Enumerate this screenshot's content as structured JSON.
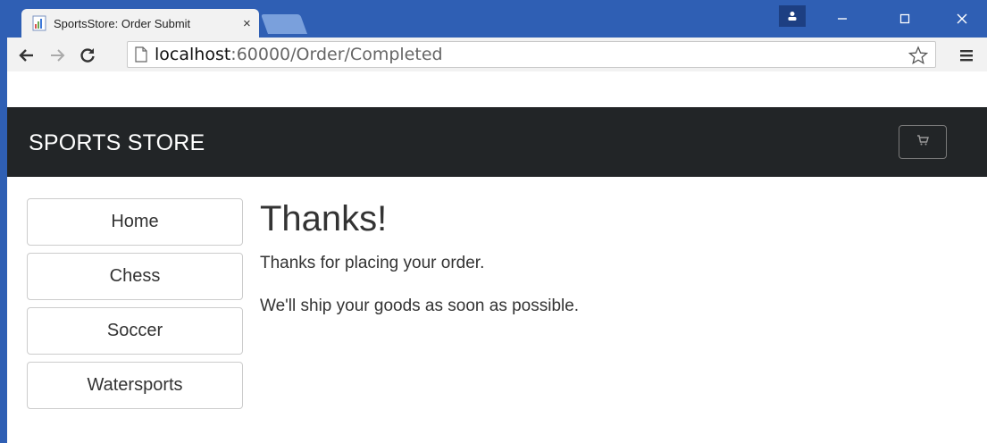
{
  "browser": {
    "tab_title": "SportsStore: Order Submit",
    "tab_close": "×",
    "url_host": "localhost",
    "url_path": ":60000/Order/Completed"
  },
  "navbar": {
    "brand": "SPORTS STORE"
  },
  "sidebar": {
    "items": [
      {
        "label": "Home"
      },
      {
        "label": "Chess"
      },
      {
        "label": "Soccer"
      },
      {
        "label": "Watersports"
      }
    ]
  },
  "main": {
    "heading": "Thanks!",
    "paragraph1": "Thanks for placing your order.",
    "paragraph2": "We'll ship your goods as soon as possible."
  },
  "colors": {
    "chrome_blue": "#2f5fb4",
    "navbar_dark": "#222527"
  },
  "icons": {
    "tab": "page-icon",
    "back": "back-arrow-icon",
    "forward": "forward-arrow-icon",
    "reload": "reload-icon",
    "page": "page-icon",
    "star": "star-icon",
    "menu": "menu-icon",
    "cart": "cart-icon"
  }
}
